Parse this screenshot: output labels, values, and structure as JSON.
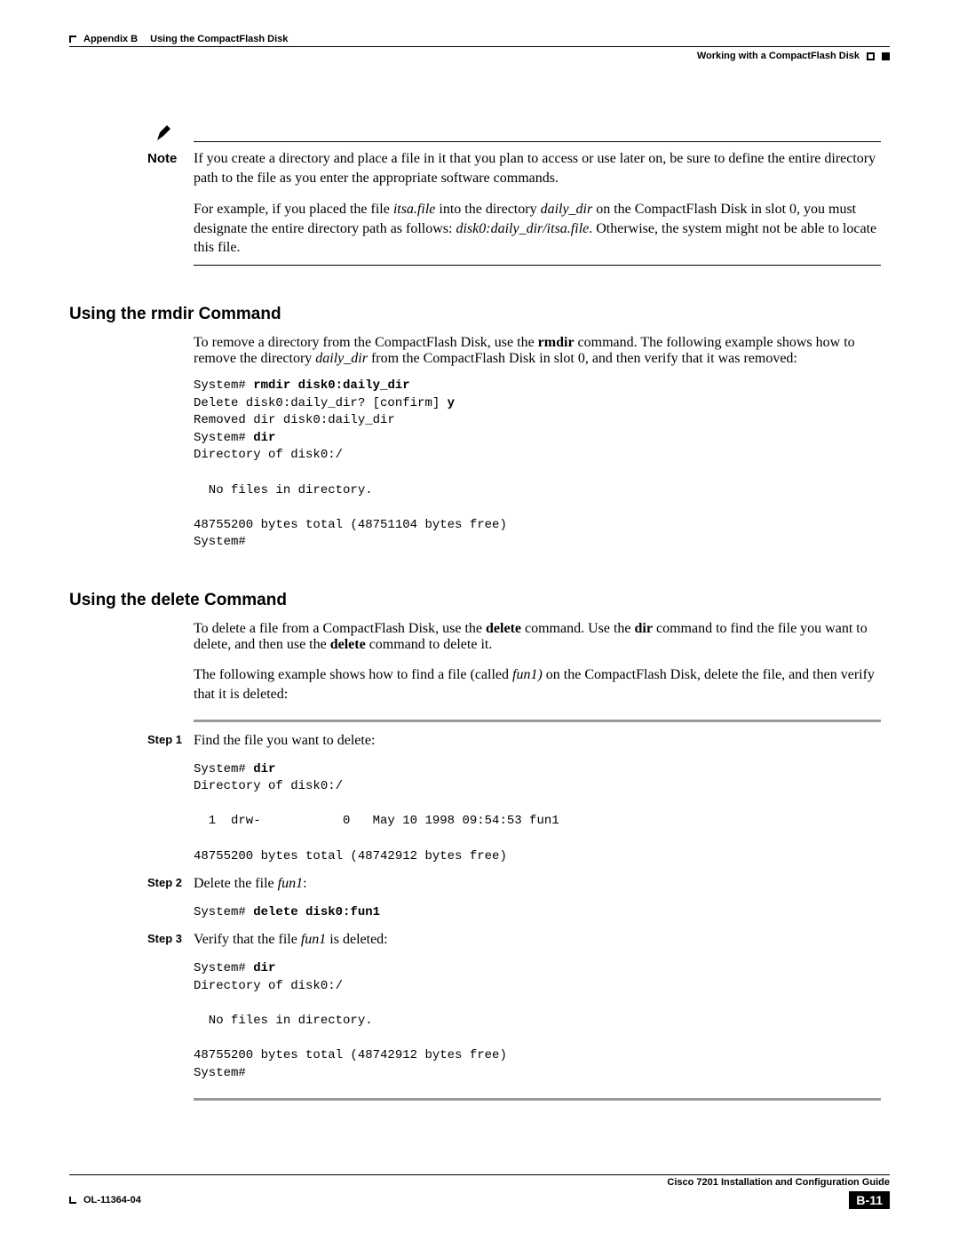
{
  "header": {
    "appendix": "Appendix B",
    "chapter": "Using the CompactFlash Disk",
    "section": "Working with a CompactFlash Disk"
  },
  "note": {
    "label": "Note",
    "line1": "If you create a directory and place a file in it that you plan to access or use later on, be sure to define the entire directory path to the file as you enter the appropriate software commands."
  },
  "example_para": {
    "pre": "For example, if you placed the file ",
    "file": "itsa.file",
    "mid1": " into the directory ",
    "dir": "daily_dir",
    "mid2": " on the CompactFlash Disk in slot 0, you must designate the entire directory path as follows: ",
    "path": "disk0:daily_dir/itsa.file",
    "post": ". Otherwise, the system might not be able to locate this file."
  },
  "rmdir": {
    "title": "Using the rmdir Command",
    "intro_pre": "To remove a directory from the CompactFlash Disk, use the ",
    "cmd": "rmdir",
    "intro_mid": " command. The following example shows how to remove the directory ",
    "dir": "daily_dir",
    "intro_post": " from the CompactFlash Disk in slot 0, and then verify that it was removed:",
    "code": {
      "l1a": "System# ",
      "l1b": "rmdir disk0:daily_dir",
      "l2a": "Delete disk0:daily_dir? [confirm] ",
      "l2b": "y",
      "l3": "Removed dir disk0:daily_dir",
      "l4a": "System# ",
      "l4b": "dir",
      "l5": "Directory of disk0:/",
      "l6": "  No files in directory.",
      "l7": "48755200 bytes total (48751104 bytes free)",
      "l8": "System#"
    }
  },
  "delete": {
    "title": "Using the delete Command",
    "intro_pre": "To delete a file from a CompactFlash Disk, use the ",
    "cmd1": "delete",
    "intro_mid1": " command. Use the ",
    "cmd2": "dir",
    "intro_mid2": " command to find the file you want to delete, and then use the ",
    "cmd3": "delete",
    "intro_post": " command to delete it.",
    "para2_pre": "The following example shows how to find a file (called ",
    "file": "fun1)",
    "para2_post": " on the CompactFlash Disk, delete the file, and then verify that it is deleted:"
  },
  "steps": {
    "s1": {
      "label": "Step 1",
      "text": "Find the file you want to delete:",
      "code": {
        "l1a": "System# ",
        "l1b": "dir",
        "l2": "Directory of disk0:/",
        "l3": "  1  drw-           0   May 10 1998 09:54:53 fun1",
        "l4": "48755200 bytes total (48742912 bytes free)"
      }
    },
    "s2": {
      "label": "Step 2",
      "text_pre": "Delete the file ",
      "file": "fun1",
      "text_post": ":",
      "code": {
        "l1a": "System# ",
        "l1b": "delete disk0:fun1"
      }
    },
    "s3": {
      "label": "Step 3",
      "text_pre": "Verify that the file ",
      "file": "fun1",
      "text_post": " is deleted:",
      "code": {
        "l1a": "System# ",
        "l1b": "dir",
        "l2": "Directory of disk0:/",
        "l3": "  No files in directory.",
        "l4": "48755200 bytes total (48742912 bytes free)",
        "l5": "System#"
      }
    }
  },
  "footer": {
    "guide": "Cisco 7201 Installation and Configuration Guide",
    "doc": "OL-11364-04",
    "page": "B-11"
  }
}
